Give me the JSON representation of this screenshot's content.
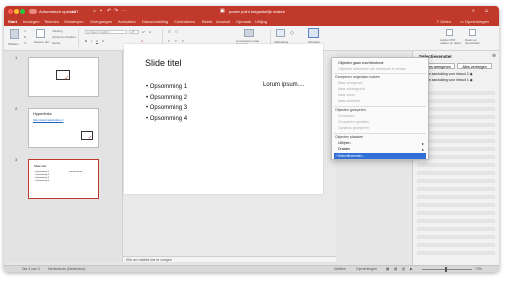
{
  "titlebar": {
    "autosave_label": "Automatisch opslaan",
    "autosave_state": "UIT",
    "doc_title": "power point toegankelijk maken",
    "share_label": "Delen",
    "comments_label": "Opmerkingen"
  },
  "tabs": [
    "Start",
    "Invoegen",
    "Tekenen",
    "Ontwerpen",
    "Overgangen",
    "Animaties",
    "Diavoorstelling",
    "Controleren",
    "Beeld",
    "Acrobat",
    "Opmaak",
    "Uitlijng"
  ],
  "ribbon": {
    "paste": "Plakken",
    "new_slide": "Nieuwe dia",
    "layout": "Indeling",
    "reset": "Opnieuw instellen",
    "section": "Sectie",
    "font_placeholder": "Lichaam (Calibri)",
    "font_size": "28",
    "convert_label": "Converteren naar SmartArt",
    "picture_label": "Afbeelding",
    "arrange_label": "Schikken",
    "adobe_create": "Adobe PDF maken en delen",
    "adobe_share": "Delen en beoordelen"
  },
  "thumbnails": {
    "slide2_title": "Hyperlinks",
    "slide2_link": "https://www.helpwindows.nl",
    "slide3_title": "Slide titel",
    "slide3_bullets": [
      "• Opsomming 1",
      "• Opsomming 2",
      "• Opsomming 3",
      "• Opsomming 4"
    ],
    "slide3_side": "Lorum ipsum..."
  },
  "slide": {
    "title": "Slide titel",
    "bullets": [
      "• Opsomming 1",
      "• Opsomming 2",
      "• Opsomming 3",
      "• Opsomming 4"
    ],
    "side_text": "Lorum ipsum...."
  },
  "notes": "Klik om notities toe te voegen",
  "menu": {
    "top1": "Objecten gaan voor/tekstvoor",
    "top2": "Objecten selecteren die eventueel te vinden",
    "h1": "Groeperen ongedaan maken",
    "h1_items": [
      "Naar voorgrond",
      "Naar achtergrond",
      "Naar voren",
      "Naar achteren"
    ],
    "h2": "Objecten groeperen",
    "h2_items": [
      "Groeperen",
      "Groeperen opheffen",
      "Opnieuw groeperen"
    ],
    "h3": "Objecten plaatsen",
    "h3_items": [
      "Uitlijnen",
      "Draaien",
      "Selectievenster..."
    ]
  },
  "selection_pane": {
    "title": "Selectievenster",
    "show_all": "Alles weergeven",
    "hide_all": "Alles verbergen",
    "items": [
      "Tijdelijke aanduiding voor inhoud 2",
      "Tijdelijke aanduiding voor inhoud 1"
    ]
  },
  "status": {
    "slide_of": "Dia 3 van 3",
    "language": "Nederlands (Nederland)",
    "notes_btn": "Notities",
    "comments_btn": "Opmerkingen",
    "zoom": "73%"
  }
}
